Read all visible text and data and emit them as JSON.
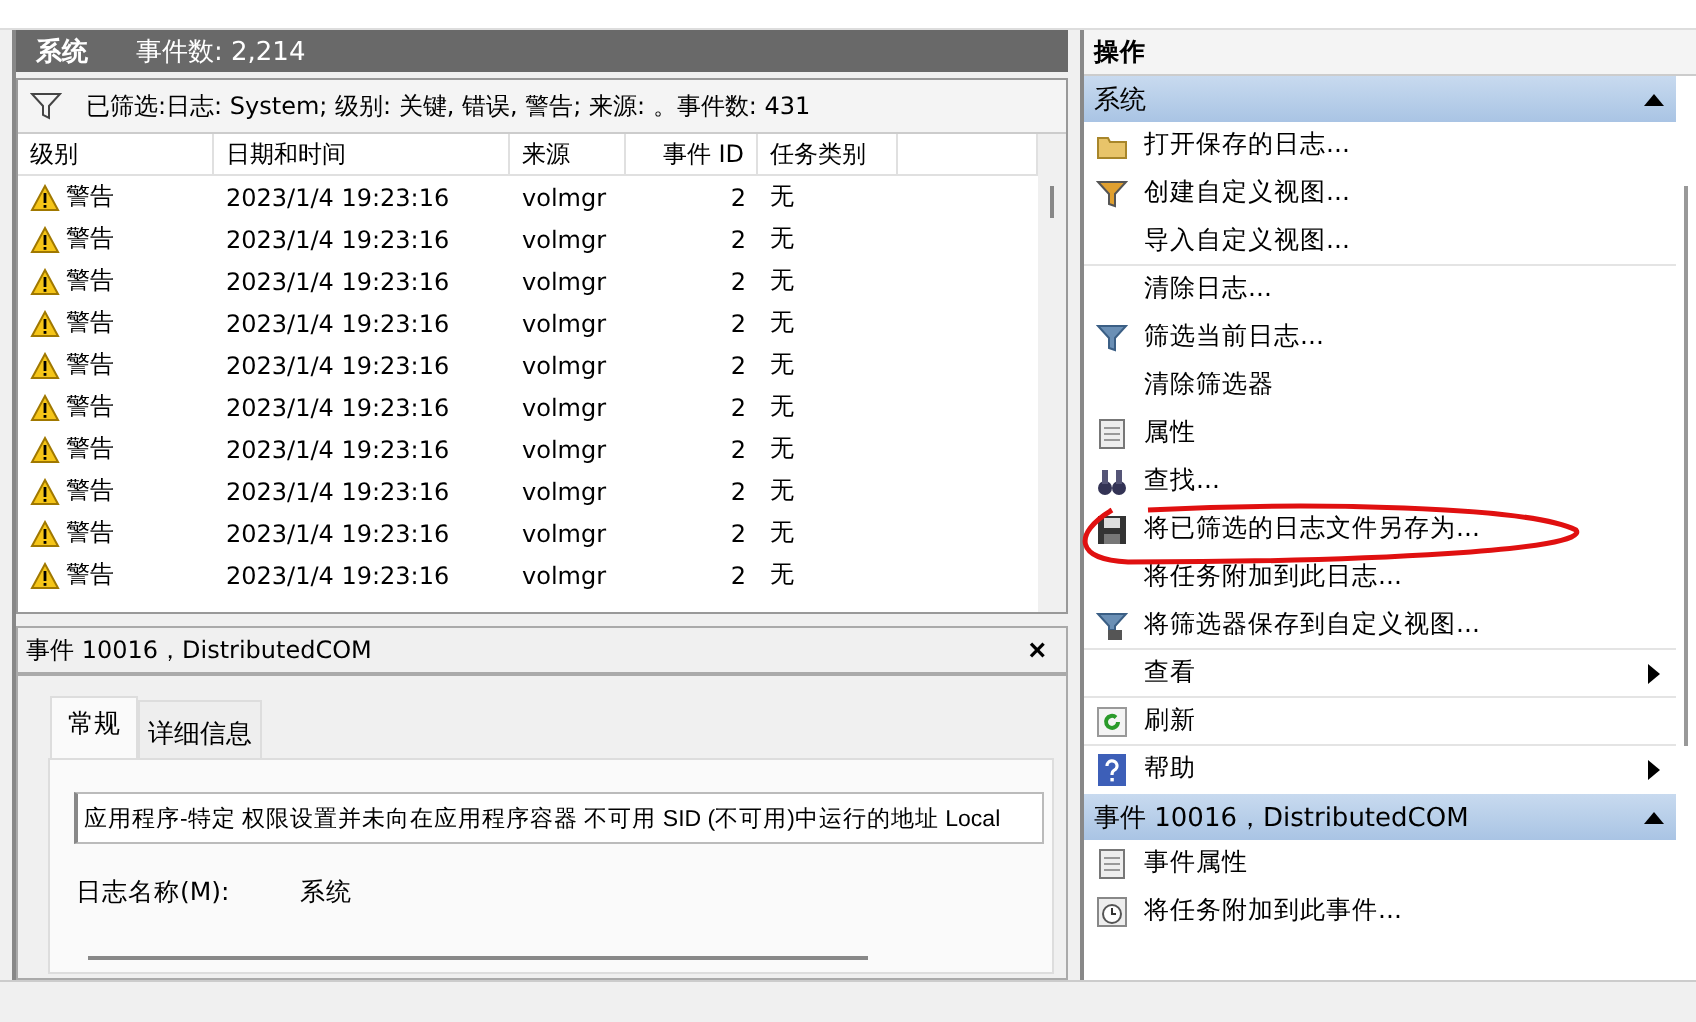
{
  "log_header": {
    "name": "系统",
    "count": "事件数: 2,214"
  },
  "filter_bar": {
    "text": "已筛选:日志: System; 级别: 关键, 错误, 警告; 来源: 。事件数: 431"
  },
  "table": {
    "columns": [
      "级别",
      "日期和时间",
      "来源",
      "事件 ID",
      "任务类别"
    ],
    "rows": [
      {
        "level": "警告",
        "kind": "warning",
        "time": "2023/1/4 19:23:16",
        "source": "volmgr",
        "id": "2",
        "task": "无"
      },
      {
        "level": "警告",
        "kind": "warning",
        "time": "2023/1/4 19:23:16",
        "source": "volmgr",
        "id": "2",
        "task": "无"
      },
      {
        "level": "警告",
        "kind": "warning",
        "time": "2023/1/4 19:23:16",
        "source": "volmgr",
        "id": "2",
        "task": "无"
      },
      {
        "level": "警告",
        "kind": "warning",
        "time": "2023/1/4 19:23:16",
        "source": "volmgr",
        "id": "2",
        "task": "无"
      },
      {
        "level": "警告",
        "kind": "warning",
        "time": "2023/1/4 19:23:16",
        "source": "volmgr",
        "id": "2",
        "task": "无"
      },
      {
        "level": "警告",
        "kind": "warning",
        "time": "2023/1/4 19:23:16",
        "source": "volmgr",
        "id": "2",
        "task": "无"
      },
      {
        "level": "警告",
        "kind": "warning",
        "time": "2023/1/4 19:23:16",
        "source": "volmgr",
        "id": "2",
        "task": "无"
      },
      {
        "level": "警告",
        "kind": "warning",
        "time": "2023/1/4 19:23:16",
        "source": "volmgr",
        "id": "2",
        "task": "无"
      },
      {
        "level": "警告",
        "kind": "warning",
        "time": "2023/1/4 19:23:16",
        "source": "volmgr",
        "id": "2",
        "task": "无"
      },
      {
        "level": "警告",
        "kind": "warning",
        "time": "2023/1/4 19:23:16",
        "source": "volmgr",
        "id": "2",
        "task": "无"
      }
    ]
  },
  "event_panel": {
    "title": "事件 10016，DistributedCOM",
    "close": "×",
    "tabs": [
      {
        "label": "常规",
        "selected": true
      },
      {
        "label": "详细信息",
        "selected": false
      }
    ],
    "description": "应用程序-特定 权限设置并未向在应用程序容器 不可用 SID (不可用)中运行的地址 Local",
    "fields": [
      {
        "label": "日志名称(M):",
        "value": "系统"
      }
    ]
  },
  "actions": {
    "title": "操作",
    "sections": [
      {
        "title": "系统",
        "expanded": true,
        "items": [
          {
            "label": "打开保存的日志...",
            "kind": "folder",
            "divider": false,
            "submenu": false
          },
          {
            "label": "创建自定义视图...",
            "kind": "filter-star",
            "divider": false,
            "submenu": false
          },
          {
            "label": "导入自定义视图...",
            "kind": "plain",
            "divider": true,
            "submenu": false
          },
          {
            "label": "清除日志...",
            "kind": "plain",
            "divider": false,
            "submenu": false
          },
          {
            "label": "筛选当前日志...",
            "kind": "filter",
            "divider": false,
            "submenu": false
          },
          {
            "label": "清除筛选器",
            "kind": "plain",
            "divider": false,
            "submenu": false
          },
          {
            "label": "属性",
            "kind": "properties",
            "divider": false,
            "submenu": false
          },
          {
            "label": "查找...",
            "kind": "binoculars",
            "divider": false,
            "submenu": false
          },
          {
            "label": "将已筛选的日志文件另存为...",
            "kind": "save",
            "divider": false,
            "submenu": false
          },
          {
            "label": "将任务附加到此日志...",
            "kind": "plain",
            "divider": false,
            "submenu": false
          },
          {
            "label": "将筛选器保存到自定义视图...",
            "kind": "filter-save",
            "divider": true,
            "submenu": false
          },
          {
            "label": "查看",
            "kind": "plain",
            "divider": true,
            "submenu": true
          },
          {
            "label": "刷新",
            "kind": "refresh",
            "divider": true,
            "submenu": false
          },
          {
            "label": "帮助",
            "kind": "help",
            "divider": false,
            "submenu": true
          }
        ]
      },
      {
        "title": "事件 10016，DistributedCOM",
        "expanded": true,
        "items": [
          {
            "label": "事件属性",
            "kind": "properties",
            "divider": false,
            "submenu": false
          },
          {
            "label": "将任务附加到此事件...",
            "kind": "task-clock",
            "divider": false,
            "submenu": false
          }
        ]
      }
    ]
  }
}
